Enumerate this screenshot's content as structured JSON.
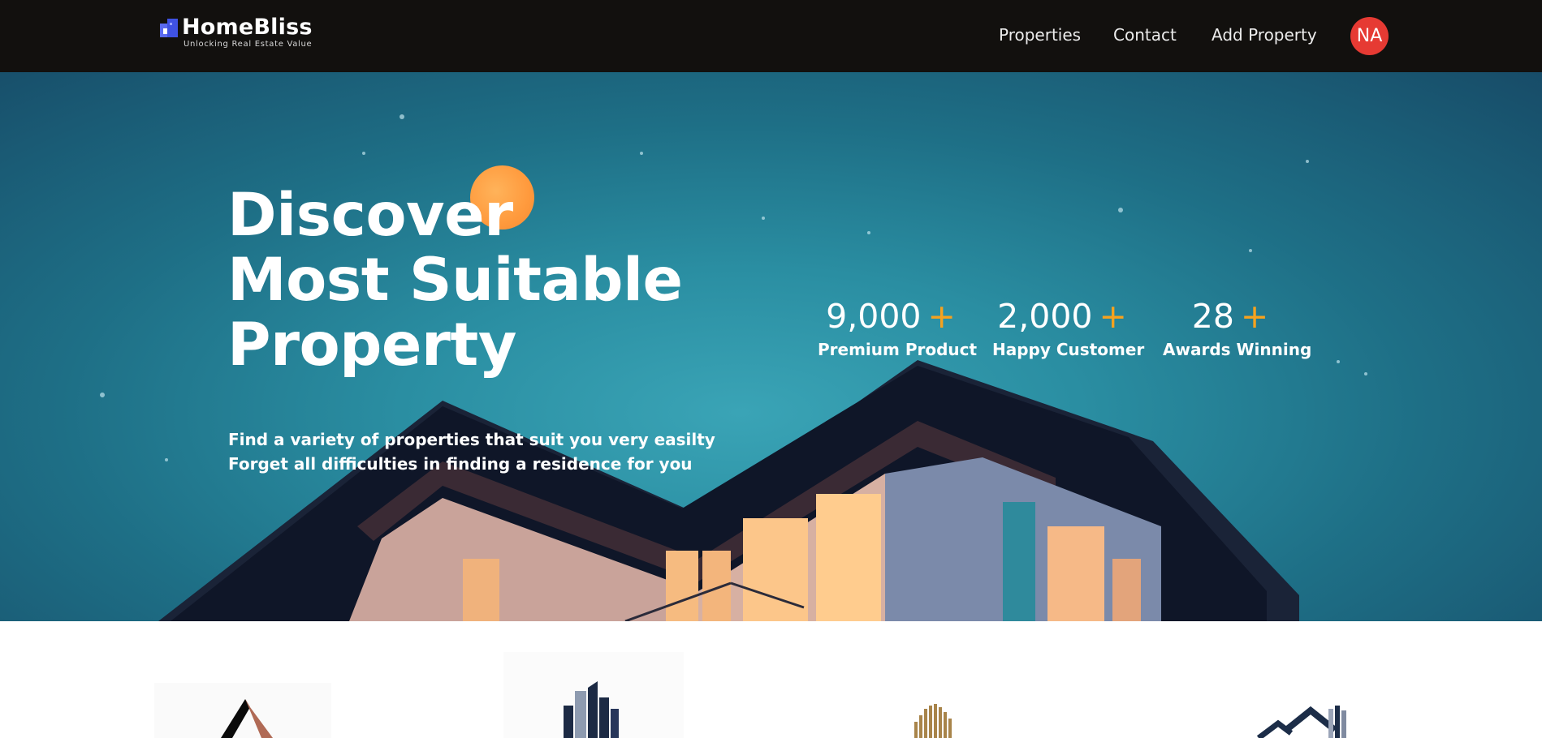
{
  "brand": {
    "name": "HomeBliss",
    "tagline": "Unlocking Real Estate Value",
    "logo_icon": "building-icon"
  },
  "nav": {
    "properties": "Properties",
    "contact": "Contact",
    "add_property": "Add Property",
    "avatar_initials": "NA"
  },
  "hero": {
    "title_lines": [
      "Discover",
      "Most Suitable",
      "Property"
    ],
    "subtitle_lines": [
      "Find a variety of properties that suit you very easilty",
      "Forget all difficulties in finding a residence for you"
    ],
    "stats": [
      {
        "value": "9,000",
        "suffix": "+",
        "label": "Premium Product"
      },
      {
        "value": "2,000",
        "suffix": "+",
        "label": "Happy Customer"
      },
      {
        "value": "28",
        "suffix": "+",
        "label": "Awards Winning"
      }
    ]
  },
  "partners": [
    {
      "icon": "roof-triangle-logo-icon"
    },
    {
      "icon": "skyscraper-logo-icon"
    },
    {
      "icon": "gold-building-logo-icon"
    },
    {
      "icon": "house-roof-logo-icon"
    }
  ],
  "colors": {
    "header_bg": "#12100e",
    "accent_orange": "#f6a21e",
    "avatar_red": "#e63a33",
    "sun": "#ff9a3d"
  }
}
